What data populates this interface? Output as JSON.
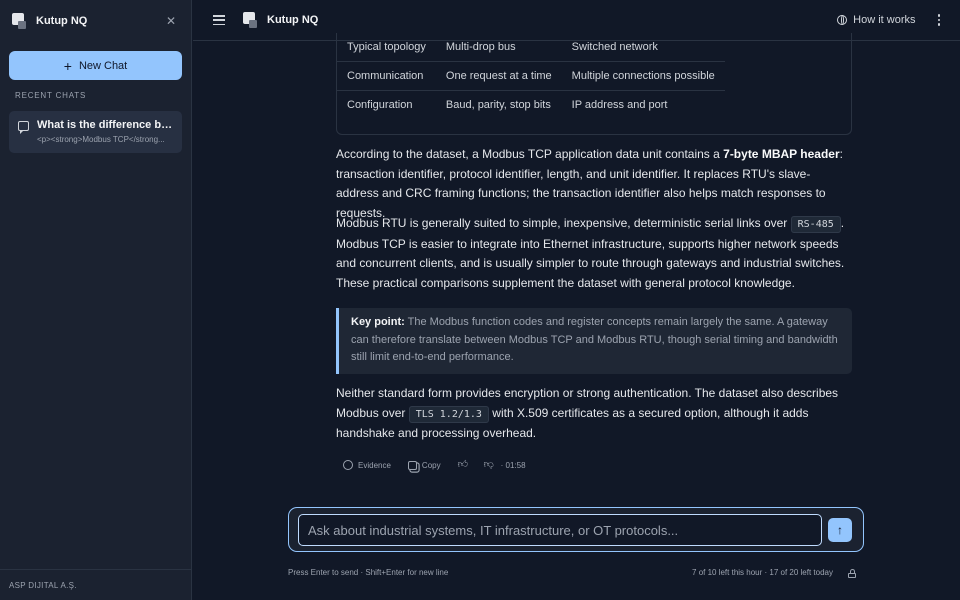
{
  "app": {
    "name": "Kutup NQ"
  },
  "sidebar": {
    "new_chat_label": "New Chat",
    "recent_label": "RECENT CHATS",
    "chats": [
      {
        "title": "What is the difference bet...",
        "preview": "<p><strong>Modbus TCP</strong..."
      }
    ],
    "footer": "ASP DIJITAL A.Ş."
  },
  "topbar": {
    "title": "Kutup NQ",
    "how_it_works": "How it works"
  },
  "table": {
    "rows": [
      [
        "Typical topology",
        "Multi-drop bus",
        "Switched network"
      ],
      [
        "Communication",
        "One request at a time",
        "Multiple connections possible"
      ],
      [
        "Configuration",
        "Baud, parity, stop bits",
        "IP address and port"
      ]
    ]
  },
  "message": {
    "p1_a": "According to the dataset, a Modbus TCP application data unit contains a ",
    "p1_bold": "7-byte MBAP header",
    "p1_b": ": transaction identifier, protocol identifier, length, and unit identifier. It replaces RTU's slave-address and CRC framing functions; the transaction identifier also helps match responses to requests.",
    "p2_a": "Modbus RTU is generally suited to simple, inexpensive, deterministic serial links over ",
    "p2_code": "RS-485",
    "p2_b": ". Modbus TCP is easier to integrate into Ethernet infrastructure, supports higher network speeds and concurrent clients, and is usually simpler to route through gateways and industrial switches. These practical comparisons supplement the dataset with general protocol knowledge.",
    "callout_bold": "Key point:",
    "callout_text": " The Modbus function codes and register concepts remain largely the same. A gateway can therefore translate between Modbus TCP and Modbus RTU, though serial timing and bandwidth still limit end-to-end performance.",
    "p3_a": "Neither standard form provides encryption or strong authentication. The dataset also describes Modbus over ",
    "p3_code": "TLS 1.2/1.3",
    "p3_b": " with X.509 certificates as a secured option, although it adds handshake and processing overhead."
  },
  "actions": {
    "evidence": "Evidence",
    "copy": "Copy",
    "time": "· 01:58"
  },
  "composer": {
    "placeholder": "Ask about industrial systems, IT infrastructure, or OT protocols...",
    "hint": "Press Enter to send · Shift+Enter for new line",
    "limits": "7 of 10 left this hour · 17 of 20 left today"
  },
  "colors": {
    "accent": "#93c5fd",
    "background": "#111827",
    "sidebar": "#1b2230"
  }
}
